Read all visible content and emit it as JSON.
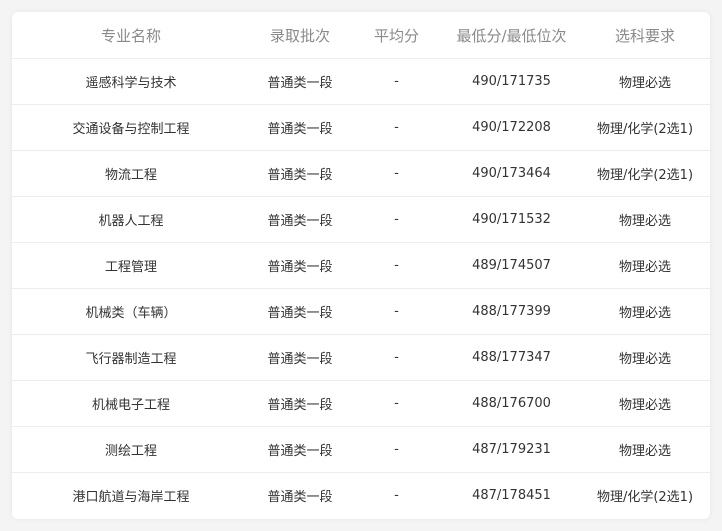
{
  "table": {
    "headers": [
      "专业名称",
      "录取批次",
      "平均分",
      "最低分/最低位次",
      "选科要求"
    ],
    "rows": [
      [
        "遥感科学与技术",
        "普通类一段",
        "-",
        "490/171735",
        "物理必选"
      ],
      [
        "交通设备与控制工程",
        "普通类一段",
        "-",
        "490/172208",
        "物理/化学(2选1)"
      ],
      [
        "物流工程",
        "普通类一段",
        "-",
        "490/173464",
        "物理/化学(2选1)"
      ],
      [
        "机器人工程",
        "普通类一段",
        "-",
        "490/171532",
        "物理必选"
      ],
      [
        "工程管理",
        "普通类一段",
        "-",
        "489/174507",
        "物理必选"
      ],
      [
        "机械类（车辆）",
        "普通类一段",
        "-",
        "488/177399",
        "物理必选"
      ],
      [
        "飞行器制造工程",
        "普通类一段",
        "-",
        "488/177347",
        "物理必选"
      ],
      [
        "机械电子工程",
        "普通类一段",
        "-",
        "488/176700",
        "物理必选"
      ],
      [
        "测绘工程",
        "普通类一段",
        "-",
        "487/179231",
        "物理必选"
      ],
      [
        "港口航道与海岸工程",
        "普通类一段",
        "-",
        "487/178451",
        "物理/化学(2选1)"
      ]
    ]
  }
}
